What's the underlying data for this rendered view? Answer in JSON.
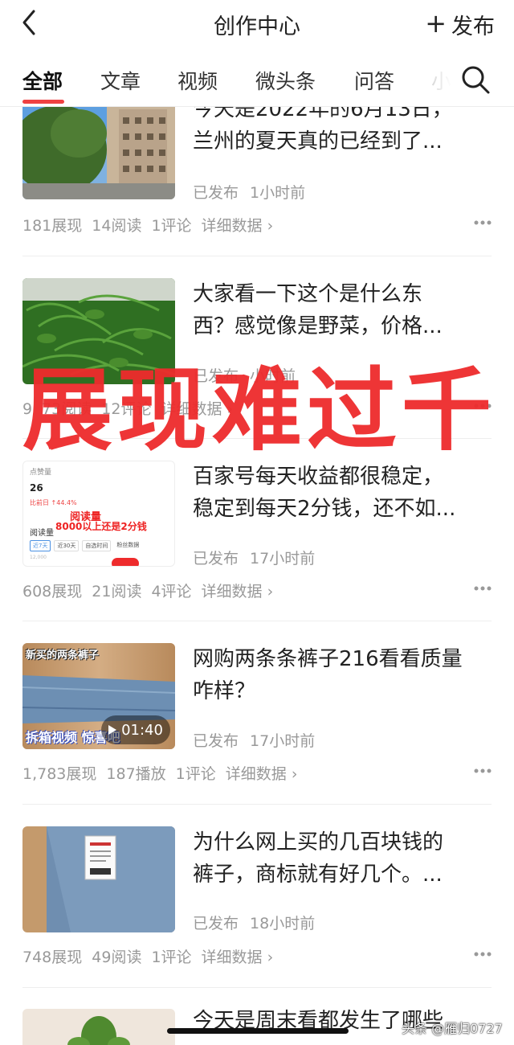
{
  "header": {
    "title": "创作中心",
    "publish_label": "发布"
  },
  "tabs": [
    {
      "label": "全部"
    },
    {
      "label": "文章"
    },
    {
      "label": "视频"
    },
    {
      "label": "微头条"
    },
    {
      "label": "问答"
    },
    {
      "label": "小"
    }
  ],
  "overlay": {
    "text": "展现难过千"
  },
  "items": [
    {
      "title_lines": [
        "今天是2022年的6月13日，",
        "兰州的夏天真的已经到了..."
      ],
      "status": "已发布",
      "time": "1小时前",
      "impressions": "181展现",
      "reads": "14阅读",
      "comments": "1评论",
      "detail": "详细数据"
    },
    {
      "title_lines": [
        "大家看一下这个是什么东",
        "西？感觉像是野菜，价格..."
      ],
      "status": "已发布",
      "time": "小时前",
      "impressions": "9",
      "reads": "73阅读",
      "comments": "12评论",
      "detail": "详细数据"
    },
    {
      "title_lines": [
        "百家号每天收益都很稳定，",
        "稳定到每天2分钱，还不如..."
      ],
      "status": "已发布",
      "time": "17小时前",
      "impressions": "608展现",
      "reads": "21阅读",
      "comments": "4评论",
      "detail": "详细数据",
      "thumb_texts": {
        "label": "点赞量",
        "value": "26",
        "compare": "比前日 ↑44.4%",
        "red_line1": "阅读量",
        "red_line2": "8000以上还是2分钱",
        "dropdown": "阅读量",
        "chip1": "近7天",
        "chip2": "近30天",
        "chip3": "自选时间",
        "chip4": "粉丝数据",
        "small": "12,000"
      }
    },
    {
      "title_lines": [
        "网购两条条裤子216看看质量",
        "咋样？"
      ],
      "status": "已发布",
      "time": "17小时前",
      "impressions": "1,783展现",
      "reads": "187播放",
      "comments": "1评论",
      "detail": "详细数据",
      "thumb_texts": {
        "top": "新买的两条裤子",
        "bottom": "拆箱视频",
        "bottom2": "惊喜吧",
        "duration": "01:40"
      }
    },
    {
      "title_lines": [
        "为什么网上买的几百块钱的",
        "裤子，商标就有好几个。..."
      ],
      "status": "已发布",
      "time": "18小时前",
      "impressions": "748展现",
      "reads": "49阅读",
      "comments": "1评论",
      "detail": "详细数据"
    },
    {
      "title_lines": [
        "今天是周末看都发生了哪些"
      ]
    }
  ],
  "watermark": "头条 @雁归0727",
  "colors": {
    "accent": "#f04142",
    "overlay_red": "#ee2b2c",
    "muted_text": "#999999"
  }
}
